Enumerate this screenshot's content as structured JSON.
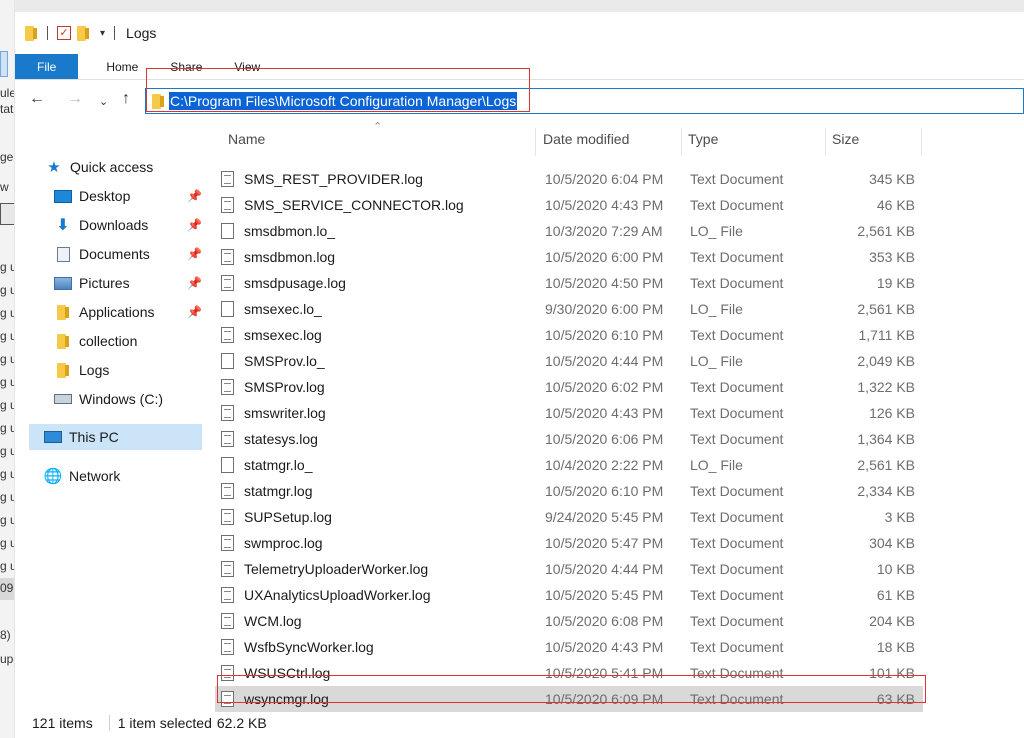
{
  "window": {
    "title": "Logs",
    "address": "C:\\Program Files\\Microsoft Configuration Manager\\Logs"
  },
  "ribbon": {
    "tabs": [
      "File",
      "Home",
      "Share",
      "View"
    ]
  },
  "background_window": {
    "fragments": [
      "ule",
      "tat",
      "ge",
      "w",
      "g u",
      "g u",
      "g u",
      "g u",
      "g u",
      "g u",
      "g u",
      "g u",
      "g u",
      "g u",
      "g u",
      "g u",
      "g u",
      "g u",
      "09",
      "8)",
      "upc"
    ]
  },
  "sidebar": {
    "items": [
      {
        "label": "Quick access",
        "icon": "star-icon"
      },
      {
        "label": "Desktop",
        "icon": "desktop-icon",
        "pinned": true
      },
      {
        "label": "Downloads",
        "icon": "download-icon",
        "pinned": true
      },
      {
        "label": "Documents",
        "icon": "document-icon",
        "pinned": true
      },
      {
        "label": "Pictures",
        "icon": "pictures-icon",
        "pinned": true
      },
      {
        "label": "Applications",
        "icon": "folder-icon",
        "pinned": true
      },
      {
        "label": "collection",
        "icon": "folder-icon"
      },
      {
        "label": "Logs",
        "icon": "folder-icon"
      },
      {
        "label": "Windows (C:)",
        "icon": "drive-icon"
      },
      {
        "label": "This PC",
        "icon": "computer-icon",
        "selected": true
      },
      {
        "label": "Network",
        "icon": "network-icon"
      }
    ]
  },
  "columns": {
    "name": "Name",
    "date": "Date modified",
    "type": "Type",
    "size": "Size"
  },
  "files": [
    {
      "name": "SMS_REST_PROVIDER.log",
      "date": "10/5/2020 6:04 PM",
      "type": "Text Document",
      "size": "345 KB"
    },
    {
      "name": "SMS_SERVICE_CONNECTOR.log",
      "date": "10/5/2020 4:43 PM",
      "type": "Text Document",
      "size": "46 KB"
    },
    {
      "name": "smsdbmon.lo_",
      "date": "10/3/2020 7:29 AM",
      "type": "LO_ File",
      "size": "2,561 KB"
    },
    {
      "name": "smsdbmon.log",
      "date": "10/5/2020 6:00 PM",
      "type": "Text Document",
      "size": "353 KB"
    },
    {
      "name": "smsdpusage.log",
      "date": "10/5/2020 4:50 PM",
      "type": "Text Document",
      "size": "19 KB"
    },
    {
      "name": "smsexec.lo_",
      "date": "9/30/2020 6:00 PM",
      "type": "LO_ File",
      "size": "2,561 KB"
    },
    {
      "name": "smsexec.log",
      "date": "10/5/2020 6:10 PM",
      "type": "Text Document",
      "size": "1,711 KB"
    },
    {
      "name": "SMSProv.lo_",
      "date": "10/5/2020 4:44 PM",
      "type": "LO_ File",
      "size": "2,049 KB"
    },
    {
      "name": "SMSProv.log",
      "date": "10/5/2020 6:02 PM",
      "type": "Text Document",
      "size": "1,322 KB"
    },
    {
      "name": "smswriter.log",
      "date": "10/5/2020 4:43 PM",
      "type": "Text Document",
      "size": "126 KB"
    },
    {
      "name": "statesys.log",
      "date": "10/5/2020 6:06 PM",
      "type": "Text Document",
      "size": "1,364 KB"
    },
    {
      "name": "statmgr.lo_",
      "date": "10/4/2020 2:22 PM",
      "type": "LO_ File",
      "size": "2,561 KB"
    },
    {
      "name": "statmgr.log",
      "date": "10/5/2020 6:10 PM",
      "type": "Text Document",
      "size": "2,334 KB"
    },
    {
      "name": "SUPSetup.log",
      "date": "9/24/2020 5:45 PM",
      "type": "Text Document",
      "size": "3 KB"
    },
    {
      "name": "swmproc.log",
      "date": "10/5/2020 5:47 PM",
      "type": "Text Document",
      "size": "304 KB"
    },
    {
      "name": "TelemetryUploaderWorker.log",
      "date": "10/5/2020 4:44 PM",
      "type": "Text Document",
      "size": "10 KB"
    },
    {
      "name": "UXAnalyticsUploadWorker.log",
      "date": "10/5/2020 5:45 PM",
      "type": "Text Document",
      "size": "61 KB"
    },
    {
      "name": "WCM.log",
      "date": "10/5/2020 6:08 PM",
      "type": "Text Document",
      "size": "204 KB"
    },
    {
      "name": "WsfbSyncWorker.log",
      "date": "10/5/2020 4:43 PM",
      "type": "Text Document",
      "size": "18 KB"
    },
    {
      "name": "WSUSCtrl.log",
      "date": "10/5/2020 5:41 PM",
      "type": "Text Document",
      "size": "101 KB"
    },
    {
      "name": "wsyncmgr.log",
      "date": "10/5/2020 6:09 PM",
      "type": "Text Document",
      "size": "63 KB",
      "selected": true
    }
  ],
  "status": {
    "item_count": "121 items",
    "selection": "1 item selected",
    "selection_size": "62.2 KB"
  },
  "colors": {
    "accent": "#1979ca",
    "selection_highlight": "#0a64d6",
    "annotation_red": "#d33333"
  }
}
